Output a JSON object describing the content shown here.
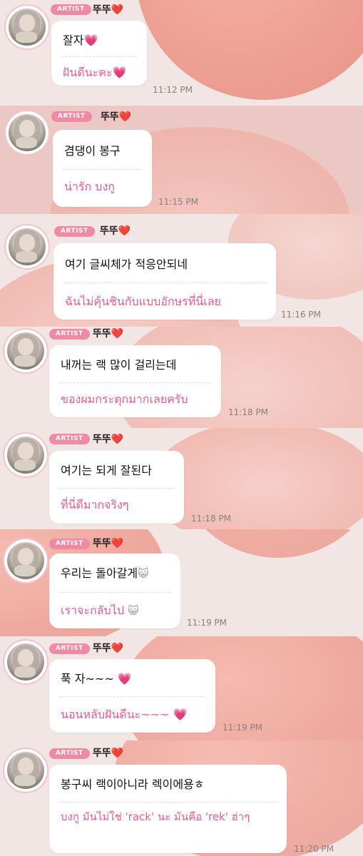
{
  "messages": [
    {
      "badge": "ARTIST",
      "name": "뚜뚜",
      "heart": "❤️",
      "korean": "잘자",
      "ko_emoji": "💗",
      "thai": "ฝันดีนะคะ",
      "th_emoji": "💗",
      "time": "11:12 PM"
    },
    {
      "badge": "ARTIST",
      "name": "뚜뚜",
      "heart": "❤️",
      "korean": "겸댕이 봉구",
      "ko_emoji": "",
      "thai": "น่ารัก บงกู",
      "th_emoji": "",
      "time": "11:15 PM"
    },
    {
      "badge": "ARTIST",
      "name": "뚜뚜",
      "heart": "❤️",
      "korean": "여기 글씨체가 적응안되네",
      "ko_emoji": "",
      "thai": "ฉันไม่คุ้นชินกับแบบอักษรที่นี่เลย",
      "th_emoji": "",
      "time": "11:16 PM"
    },
    {
      "badge": "ARTIST",
      "name": "뚜뚜",
      "heart": "❤️",
      "korean": "내꺼는 랙 많이 걸리는데",
      "ko_emoji": "",
      "thai": "ของผมกระตุกมากเลยครับ",
      "th_emoji": "",
      "time": "11:18 PM"
    },
    {
      "badge": "ARTIST",
      "name": "뚜뚜",
      "heart": "❤️",
      "korean": "여기는 되게 잘된다",
      "ko_emoji": "",
      "thai": "ที่นี่ดีมากจริงๆ",
      "th_emoji": "",
      "time": "11:18 PM"
    },
    {
      "badge": "ARTIST",
      "name": "뚜뚜",
      "heart": "❤️",
      "korean": "우리는 돌아갈게",
      "ko_emoji": "😺",
      "thai": "เราจะกลับไป",
      "th_emoji": "😺",
      "time": "11:19 PM"
    },
    {
      "badge": "ARTIST",
      "name": "뚜뚜",
      "heart": "❤️",
      "korean": "푹 자~~~",
      "ko_emoji": "💗",
      "thai": "นอนหลับฝันดีนะ~~~",
      "th_emoji": "💗",
      "time": "11:19 PM"
    },
    {
      "badge": "ARTIST",
      "name": "뚜뚜",
      "heart": "❤️",
      "korean": "봉구씨 랙이아니라 렉이에용ㅎ",
      "ko_emoji": "",
      "thai": "บงกู มันไม่ใช่ 'rack' นะ มันคือ 'rek' ฮ่าๆ",
      "th_emoji": "",
      "time": "11:20 PM"
    }
  ],
  "colors": {
    "badge": "#f08aa4",
    "thai_text": "#e85a8a",
    "bubble": "#ffffff",
    "background": "#f2e6e5",
    "heart": "#e0242b"
  },
  "icons": {
    "heart": "red-heart-icon",
    "pink_heart": "pink-heart-icon",
    "cat": "cat-face-icon"
  }
}
